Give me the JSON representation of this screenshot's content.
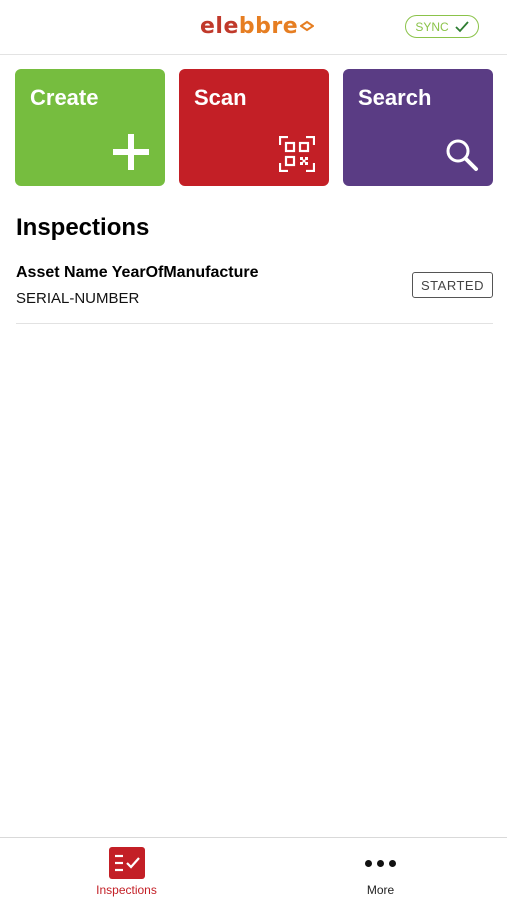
{
  "header": {
    "logo_part1": "ele",
    "logo_part2": "bbre",
    "sync_label": "SYNC"
  },
  "tiles": [
    {
      "label": "Create",
      "icon": "plus-icon",
      "color": "#76bd3f"
    },
    {
      "label": "Scan",
      "icon": "qr-code-icon",
      "color": "#c31f26"
    },
    {
      "label": "Search",
      "icon": "search-icon",
      "color": "#5a3c84"
    }
  ],
  "inspections": {
    "title": "Inspections",
    "items": [
      {
        "name": "Asset Name YearOfManufacture",
        "serial": "SERIAL-NUMBER",
        "status": "STARTED"
      }
    ]
  },
  "tabbar": {
    "tabs": [
      {
        "label": "Inspections",
        "icon": "checklist-icon",
        "active": true
      },
      {
        "label": "More",
        "icon": "more-dots-icon",
        "active": false
      }
    ]
  },
  "colors": {
    "accent_red": "#c31f26",
    "sync_green": "#8bc34a"
  }
}
